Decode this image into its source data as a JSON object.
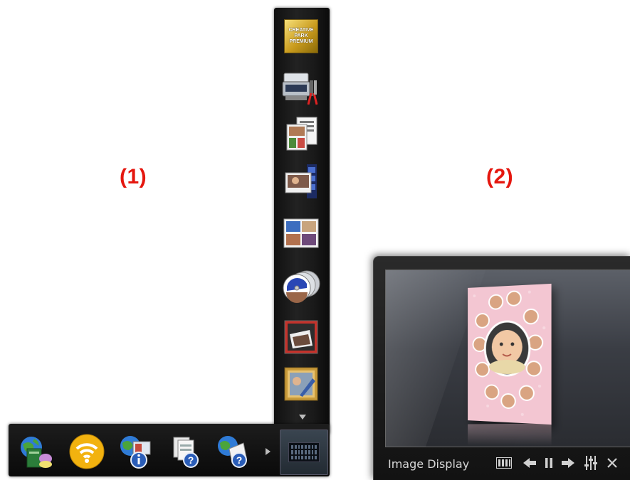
{
  "callouts": {
    "label_1": "(1)",
    "label_2": "(2)"
  },
  "menu_vertical": {
    "items": [
      {
        "name": "creative-park-premium",
        "badge_lines": [
          "CREATIVE",
          "PARK",
          "PREMIUM"
        ]
      },
      {
        "name": "scanner-tools"
      },
      {
        "name": "photo-layouts"
      },
      {
        "name": "film-photo"
      },
      {
        "name": "collage"
      },
      {
        "name": "disc-label"
      },
      {
        "name": "photo-frame"
      },
      {
        "name": "photo-editing"
      }
    ],
    "scroll_down": "more"
  },
  "menu_horizontal": {
    "items": [
      {
        "name": "web-service"
      },
      {
        "name": "wireless-connection"
      },
      {
        "name": "web-info"
      },
      {
        "name": "help-guide"
      },
      {
        "name": "online-help"
      }
    ],
    "scroll_right": "more",
    "view_toggle": "grid-view"
  },
  "image_display": {
    "title": "Image Display",
    "controls": [
      "view",
      "previous",
      "pause",
      "next",
      "settings",
      "close"
    ]
  },
  "colors": {
    "callout": "#e5170f",
    "card": "#f3c6d2",
    "badge_gold": "#c99b1d"
  }
}
